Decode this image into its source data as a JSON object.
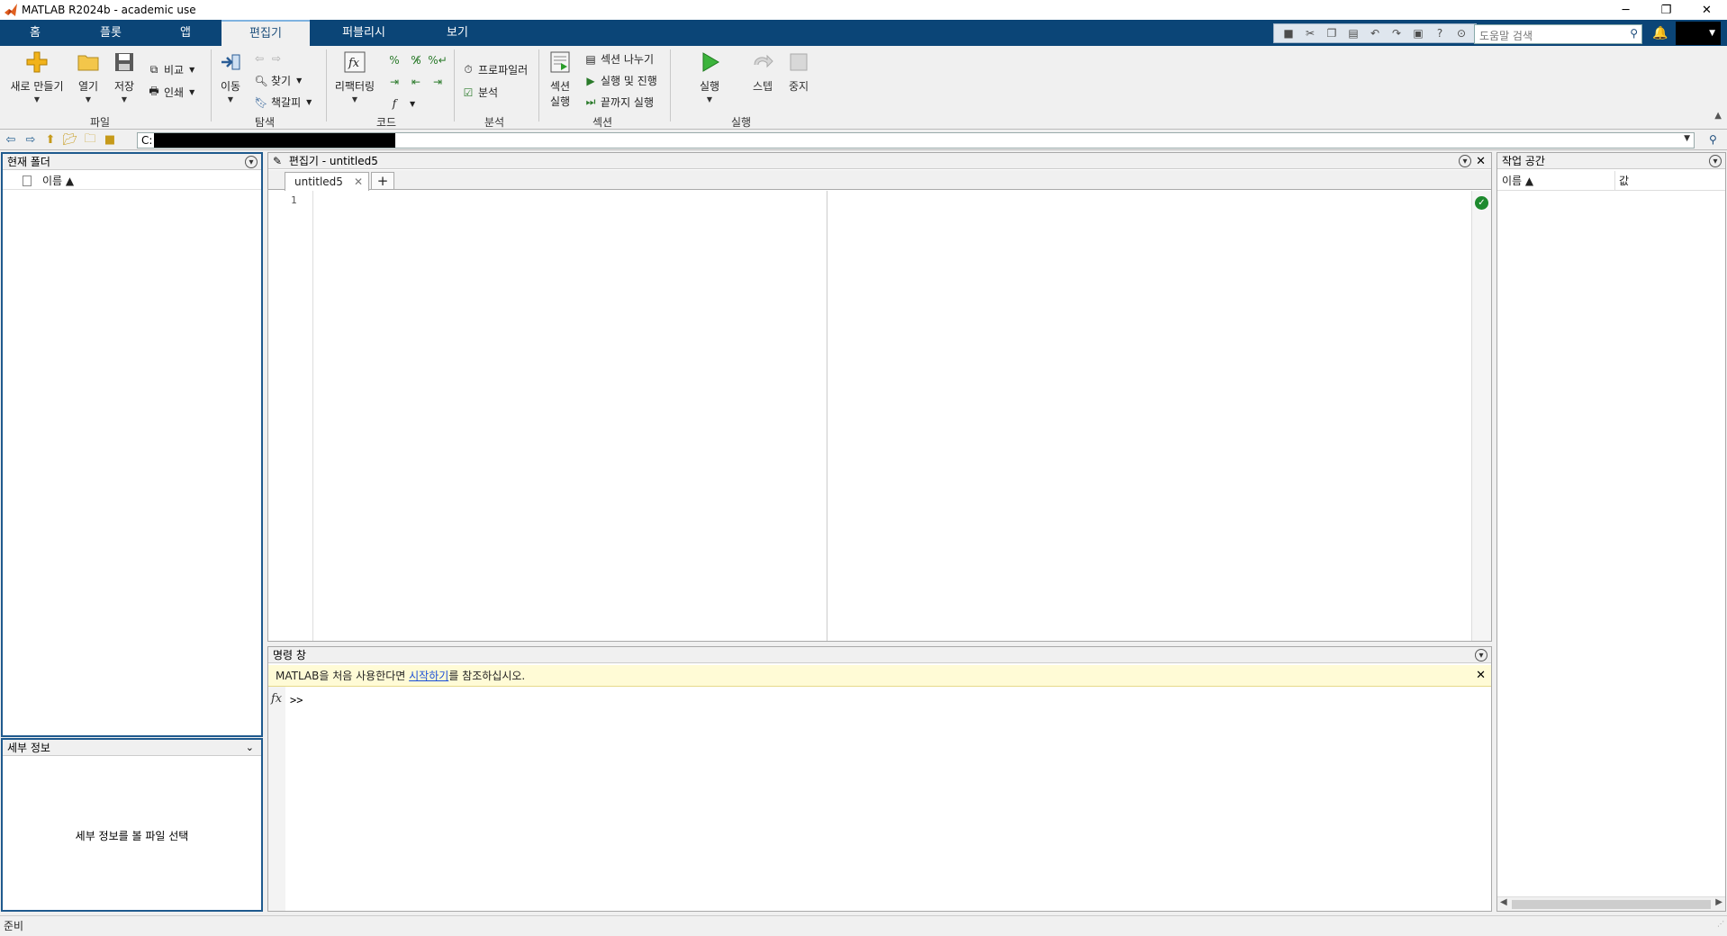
{
  "window": {
    "title": "MATLAB R2024b - academic use",
    "controls": {
      "minimize": "─",
      "restore": "❐",
      "close": "✕"
    }
  },
  "ribbon": {
    "tabs": [
      "홈",
      "플롯",
      "앱",
      "편집기",
      "퍼블리시",
      "보기"
    ],
    "active_tab": "편집기",
    "help_search_placeholder": "도움말 검색"
  },
  "toolstrip": {
    "file": {
      "group_label": "파일",
      "new_label": "새로 만들기",
      "open_label": "열기",
      "save_label": "저장",
      "compare_label": "비교",
      "print_label": "인쇄"
    },
    "navigate": {
      "group_label": "탐색",
      "goto_label": "이동",
      "find_label": "찾기",
      "bookmark_label": "책갈피"
    },
    "code": {
      "group_label": "코드",
      "refactor_label": "리팩터링"
    },
    "analyze": {
      "group_label": "분석",
      "profiler_label": "프로파일러",
      "analyze_label": "분석"
    },
    "section": {
      "group_label": "섹션",
      "run_section_label_1": "섹션",
      "run_section_label_2": "실행",
      "section_break_label": "섹션 나누기",
      "run_advance_label": "실행 및 진행",
      "run_to_end_label": "끝까지 실행"
    },
    "run": {
      "group_label": "실행",
      "run_label": "실행",
      "step_label": "스텝",
      "stop_label": "중지"
    }
  },
  "address": {
    "drive": "C:"
  },
  "current_folder": {
    "title": "현재 폴더",
    "column_name": "이름 ▲"
  },
  "details": {
    "title": "세부 정보",
    "message": "세부 정보를 볼 파일 선택"
  },
  "editor": {
    "title": "편집기 - untitled5",
    "tab_label": "untitled5",
    "line_numbers": [
      "1"
    ]
  },
  "command_window": {
    "title": "명령 창",
    "notice_before": "MATLAB을 처음 사용한다면 ",
    "notice_link": "시작하기",
    "notice_after": "를 참조하십시오.",
    "prompt": ">>",
    "fx_label": "fx"
  },
  "workspace": {
    "title": "작업 공간",
    "col_name": "이름 ▲",
    "col_value": "값"
  },
  "status": {
    "text": "준비"
  },
  "colors": {
    "ribbon_bg": "#0b4577",
    "panel_focus": "#1f5a8e",
    "ok_green": "#1e8a2e",
    "notice_bg": "#fffbd6"
  }
}
